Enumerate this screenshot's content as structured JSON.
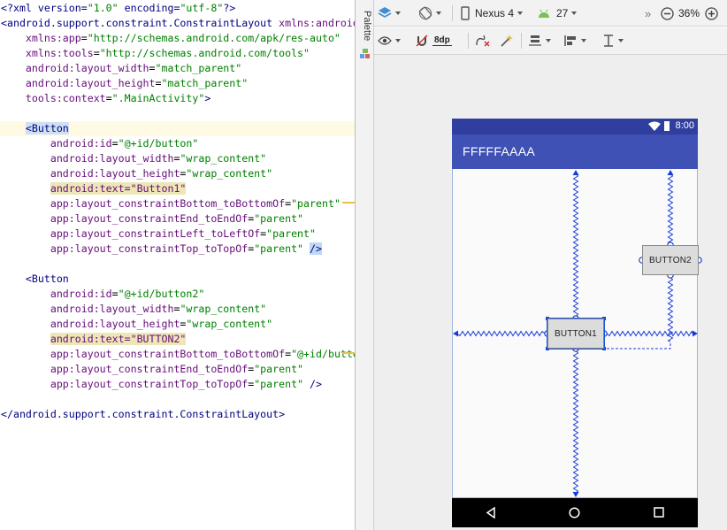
{
  "editor": {
    "lines": [
      {
        "parts": [
          {
            "t": "<?xml version=",
            "c": "tag"
          },
          {
            "t": "\"1.0\"",
            "c": "val"
          },
          {
            "t": " encoding=",
            "c": "tag"
          },
          {
            "t": "\"utf-8\"",
            "c": "val"
          },
          {
            "t": "?>",
            "c": "tag"
          }
        ]
      },
      {
        "parts": [
          {
            "t": "<android.support.constraint.ConstraintLayout ",
            "c": "tag"
          },
          {
            "t": "xmlns:android",
            "c": "attr"
          }
        ]
      },
      {
        "parts": [
          {
            "t": "    xmlns:app",
            "c": "attr"
          },
          {
            "t": "=",
            "c": "plain"
          },
          {
            "t": "\"http://schemas.android.com/apk/res-auto\"",
            "c": "val"
          }
        ]
      },
      {
        "parts": [
          {
            "t": "    xmlns:tools",
            "c": "attr"
          },
          {
            "t": "=",
            "c": "plain"
          },
          {
            "t": "\"http://schemas.android.com/tools\"",
            "c": "val"
          }
        ]
      },
      {
        "parts": [
          {
            "t": "    android:layout_width",
            "c": "attr"
          },
          {
            "t": "=",
            "c": "plain"
          },
          {
            "t": "\"match_parent\"",
            "c": "val"
          }
        ]
      },
      {
        "parts": [
          {
            "t": "    android:layout_height",
            "c": "attr"
          },
          {
            "t": "=",
            "c": "plain"
          },
          {
            "t": "\"match_parent\"",
            "c": "val"
          }
        ]
      },
      {
        "parts": [
          {
            "t": "    tools:context",
            "c": "attr"
          },
          {
            "t": "=",
            "c": "plain"
          },
          {
            "t": "\".MainActivity\"",
            "c": "val"
          },
          {
            "t": ">",
            "c": "tag"
          }
        ]
      },
      {
        "parts": []
      },
      {
        "hl": true,
        "parts": [
          {
            "t": "    ",
            "c": "plain"
          },
          {
            "t": "<Button",
            "c": "tag",
            "mark": "tagsel"
          }
        ]
      },
      {
        "parts": [
          {
            "t": "        android:id",
            "c": "attr"
          },
          {
            "t": "=",
            "c": "plain"
          },
          {
            "t": "\"@+id/button\"",
            "c": "val"
          }
        ]
      },
      {
        "parts": [
          {
            "t": "        android:layout_width",
            "c": "attr"
          },
          {
            "t": "=",
            "c": "plain"
          },
          {
            "t": "\"wrap_content\"",
            "c": "val"
          }
        ]
      },
      {
        "parts": [
          {
            "t": "        android:layout_height",
            "c": "attr"
          },
          {
            "t": "=",
            "c": "plain"
          },
          {
            "t": "\"wrap_content\"",
            "c": "val"
          }
        ]
      },
      {
        "parts": [
          {
            "t": "        ",
            "c": "plain"
          },
          {
            "t": "android:text=\"Button1\"",
            "c": "attr",
            "mark": "hl"
          }
        ]
      },
      {
        "parts": [
          {
            "t": "        app:layout_constraintBottom_toBottomOf",
            "c": "attr"
          },
          {
            "t": "=",
            "c": "plain"
          },
          {
            "t": "\"parent\"",
            "c": "val"
          }
        ]
      },
      {
        "parts": [
          {
            "t": "        app:layout_constraintEnd_toEndOf",
            "c": "attr"
          },
          {
            "t": "=",
            "c": "plain"
          },
          {
            "t": "\"parent\"",
            "c": "val"
          }
        ]
      },
      {
        "parts": [
          {
            "t": "        app:layout_constraintLeft_toLeftOf",
            "c": "attr"
          },
          {
            "t": "=",
            "c": "plain"
          },
          {
            "t": "\"parent\"",
            "c": "val"
          }
        ]
      },
      {
        "parts": [
          {
            "t": "        app:layout_constraintTop_toTopOf",
            "c": "attr"
          },
          {
            "t": "=",
            "c": "plain"
          },
          {
            "t": "\"parent\"",
            "c": "val"
          },
          {
            "t": " ",
            "c": "plain"
          },
          {
            "t": "/>",
            "c": "tag",
            "mark": "sel"
          }
        ]
      },
      {
        "parts": []
      },
      {
        "parts": [
          {
            "t": "    <Button",
            "c": "tag"
          }
        ]
      },
      {
        "parts": [
          {
            "t": "        android:id",
            "c": "attr"
          },
          {
            "t": "=",
            "c": "plain"
          },
          {
            "t": "\"@+id/button2\"",
            "c": "val"
          }
        ]
      },
      {
        "parts": [
          {
            "t": "        android:layout_width",
            "c": "attr"
          },
          {
            "t": "=",
            "c": "plain"
          },
          {
            "t": "\"wrap_content\"",
            "c": "val"
          }
        ]
      },
      {
        "parts": [
          {
            "t": "        android:layout_height",
            "c": "attr"
          },
          {
            "t": "=",
            "c": "plain"
          },
          {
            "t": "\"wrap_content\"",
            "c": "val"
          }
        ]
      },
      {
        "parts": [
          {
            "t": "        ",
            "c": "plain"
          },
          {
            "t": "android:text=\"BUTTON2\"",
            "c": "attr",
            "mark": "hl"
          }
        ]
      },
      {
        "parts": [
          {
            "t": "        app:layout_constraintBottom_toBottomOf",
            "c": "attr"
          },
          {
            "t": "=",
            "c": "plain"
          },
          {
            "t": "\"@+id/button",
            "c": "val"
          }
        ]
      },
      {
        "parts": [
          {
            "t": "        app:layout_constraintEnd_toEndOf",
            "c": "attr"
          },
          {
            "t": "=",
            "c": "plain"
          },
          {
            "t": "\"parent\"",
            "c": "val"
          }
        ]
      },
      {
        "parts": [
          {
            "t": "        app:layout_constraintTop_toTopOf",
            "c": "attr"
          },
          {
            "t": "=",
            "c": "plain"
          },
          {
            "t": "\"parent\"",
            "c": "val"
          },
          {
            "t": " />",
            "c": "tag"
          }
        ]
      },
      {
        "parts": []
      },
      {
        "parts": [
          {
            "t": "</android.support.constraint.ConstraintLayout>",
            "c": "tag"
          }
        ]
      }
    ]
  },
  "palette": {
    "label": "Palette"
  },
  "toolbar": {
    "layers_icon": "layers-icon",
    "orientation_icon": "rotate-icon",
    "device_label": "Nexus 4",
    "api_label": "27",
    "overflow_label": "»",
    "zoom_label": "36%",
    "margin_label": "8dp",
    "icons": [
      "eye-icon",
      "magnet-icon",
      "clear-constraints-icon",
      "infer-constraints-icon",
      "pack-icon",
      "align-icon",
      "guidelines-icon"
    ]
  },
  "device": {
    "status_time": "8:00",
    "app_title": "FFFFFAAAA",
    "button1_label": "BUTTON1",
    "button2_label": "BUTTON2"
  },
  "colors": {
    "status_bar": "#303f9f",
    "app_bar": "#3f51b5",
    "constraint": "#1a3cd6",
    "android_green": "#78c257"
  }
}
